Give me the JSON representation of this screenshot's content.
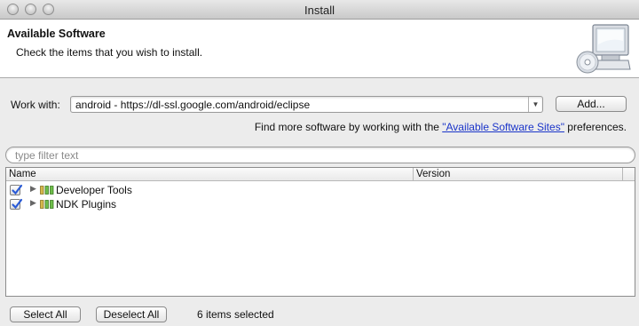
{
  "window": {
    "title": "Install"
  },
  "banner": {
    "heading": "Available Software",
    "description": "Check the items that you wish to install."
  },
  "work_with": {
    "label": "Work with:",
    "value": "android - https://dl-ssl.google.com/android/eclipse",
    "add_button": "Add..."
  },
  "more_software": {
    "prefix": "Find more software by working with the ",
    "link": "\"Available Software Sites\"",
    "suffix": " preferences."
  },
  "filter": {
    "placeholder": "type filter text"
  },
  "table": {
    "columns": [
      "Name",
      "Version"
    ],
    "rows": [
      {
        "name": "Developer Tools",
        "checked": true
      },
      {
        "name": "NDK Plugins",
        "checked": true
      }
    ]
  },
  "footer": {
    "select_all": "Select All",
    "deselect_all": "Deselect All",
    "status": "6 items selected"
  },
  "colors": {
    "link": "#1a34c9",
    "check": "#2a5bd7"
  }
}
